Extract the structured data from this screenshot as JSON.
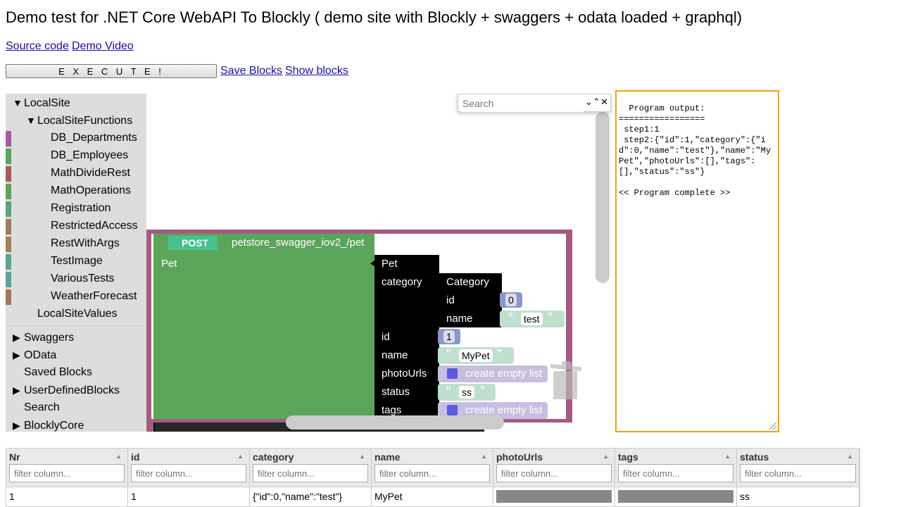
{
  "page": {
    "title": "Demo test for .NET Core WebAPI To Blockly ( demo site with Blockly + swaggers + odata loaded + graphql)",
    "links": {
      "source_code": "Source code",
      "demo_video": "Demo Video",
      "save_blocks": "Save Blocks",
      "show_blocks": "Show blocks"
    },
    "execute_label": "E X E C U T E !"
  },
  "toolbox": {
    "items": [
      {
        "label": "LocalSite",
        "expanded": true
      },
      {
        "label": "LocalSiteFunctions",
        "expanded": true
      },
      {
        "label": "DB_Departments",
        "color": "#a55b9e"
      },
      {
        "label": "DB_Employees",
        "color": "#5ba55b"
      },
      {
        "label": "MathDivideRest",
        "color": "#a55b5b"
      },
      {
        "label": "MathOperations",
        "color": "#5ba55b"
      },
      {
        "label": "Registration",
        "color": "#5ba57a"
      },
      {
        "label": "RestrictedAccess",
        "color": "#a57b5b"
      },
      {
        "label": "RestWithArgs",
        "color": "#a5805b"
      },
      {
        "label": "TestImage",
        "color": "#5ba58c"
      },
      {
        "label": "VariousTests",
        "color": "#5ba599"
      },
      {
        "label": "WeatherForecast",
        "color": "#a5745b"
      },
      {
        "label": "LocalSiteValues"
      },
      {
        "label": "Swaggers",
        "expanded": false
      },
      {
        "label": "OData",
        "expanded": false
      },
      {
        "label": "Saved Blocks"
      },
      {
        "label": "UserDefinedBlocks",
        "expanded": false
      },
      {
        "label": "Search"
      },
      {
        "label": "BlocklyCore",
        "expanded": false
      }
    ]
  },
  "workspace": {
    "search_placeholder": "Search",
    "block": {
      "method": "POST",
      "endpoint": "petstore_swagger_iov2_/pet",
      "param": "Pet",
      "pet_title": "Pet",
      "category_label": "category",
      "category_title": "Category",
      "category_id_label": "id",
      "category_id_value": "0",
      "category_name_label": "name",
      "category_name_value": "test",
      "id_label": "id",
      "id_value": "1",
      "name_label": "name",
      "name_value": "MyPet",
      "photo_label": "photoUrls",
      "photo_value": "create empty list",
      "status_label": "status",
      "status_value": "ss",
      "tags_label": "tags",
      "tags_value": "create empty list"
    },
    "colors": {
      "outer": "#a55b80",
      "post_block": "#5ba55b",
      "post_badge": "#49c08f",
      "pet_block": "#000000",
      "text_block": "#bfe0cf",
      "list_block": "#c8bee0",
      "number_block": "#8c96c8"
    }
  },
  "output": {
    "text": "Program output:\n=================\n step1:1\n step2:{\"id\":1,\"category\":{\"id\":0,\"name\":\"test\"},\"name\":\"MyPet\",\"photoUrls\":[],\"tags\":[],\"status\":\"ss\"}\n\n<< Program complete >>"
  },
  "grid": {
    "filter_placeholder": "filter column...",
    "columns": [
      "Nr",
      "id",
      "category",
      "name",
      "photoUrls",
      "tags",
      "status"
    ],
    "rows": [
      [
        "1",
        "1",
        "{\"id\":0,\"name\":\"test\"}",
        "MyPet",
        "",
        "",
        "ss"
      ]
    ]
  }
}
